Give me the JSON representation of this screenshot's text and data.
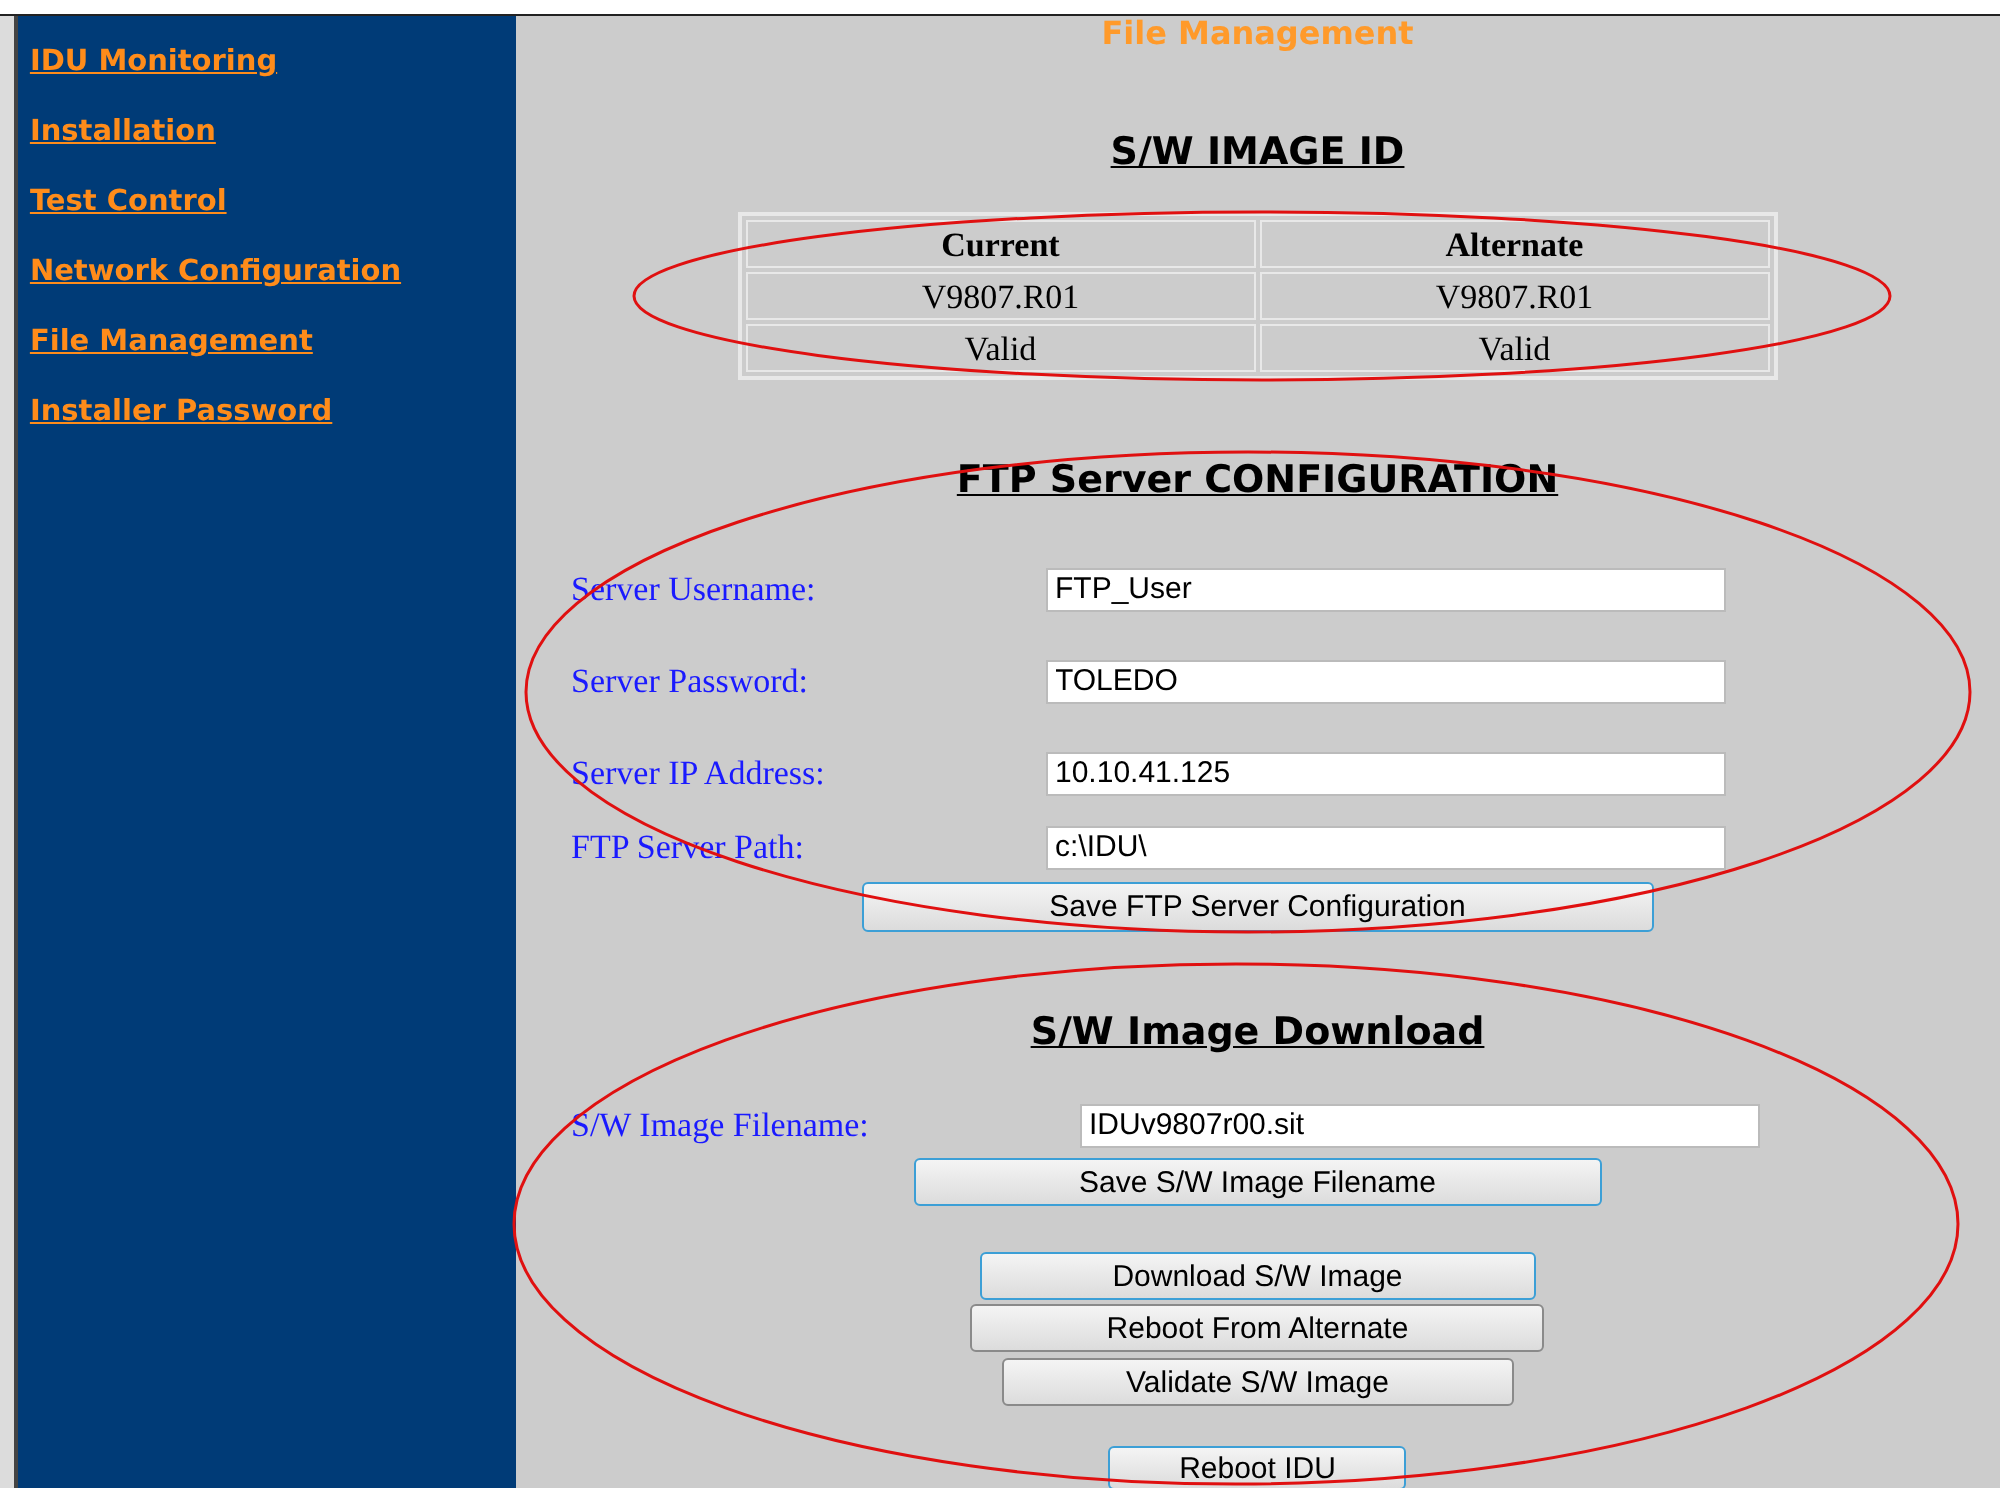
{
  "sidebar": {
    "items": [
      {
        "label": "IDU Monitoring"
      },
      {
        "label": "Installation"
      },
      {
        "label": "Test Control"
      },
      {
        "label": "Network Configuration"
      },
      {
        "label": "File Management"
      },
      {
        "label": "Installer Password"
      }
    ]
  },
  "page_title": "File Management",
  "image_id": {
    "heading": "S/W IMAGE ID",
    "columns": [
      "Current",
      "Alternate"
    ],
    "rows": [
      [
        "V9807.R01",
        "V9807.R01"
      ],
      [
        "Valid",
        "Valid"
      ]
    ]
  },
  "ftp": {
    "heading": "FTP Server CONFIGURATION",
    "fields": [
      {
        "label": "Server Username:",
        "value": "FTP_User"
      },
      {
        "label": "Server Password:",
        "value": "TOLEDO"
      },
      {
        "label": "Server IP Address:",
        "value": "10.10.41.125"
      },
      {
        "label": "FTP Server Path:",
        "value": "c:\\IDU\\"
      }
    ],
    "button": {
      "label": "Save FTP Server Configuration",
      "highlighted": true
    }
  },
  "download": {
    "heading": "S/W Image Download",
    "field": {
      "label": "S/W Image Filename:",
      "value": "IDUv9807r00.sit"
    },
    "buttons": [
      {
        "label": "Save S/W Image Filename",
        "highlighted": true
      },
      {
        "label": "Download S/W Image",
        "highlighted": true
      },
      {
        "label": "Reboot From Alternate",
        "highlighted": false
      },
      {
        "label": "Validate S/W Image",
        "highlighted": false
      },
      {
        "label": "Reboot IDU",
        "highlighted": true
      }
    ]
  }
}
